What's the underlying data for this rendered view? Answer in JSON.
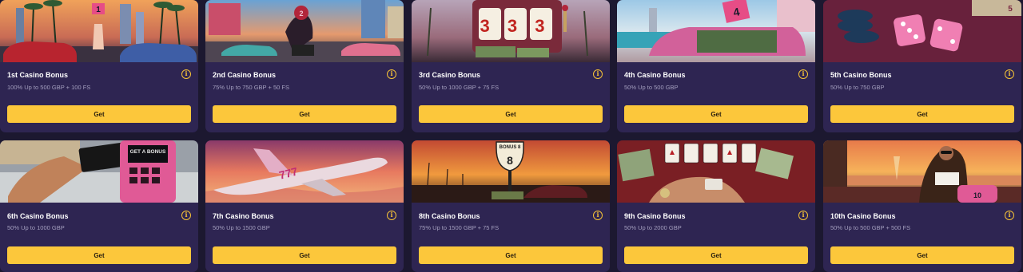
{
  "cards": [
    {
      "title": "1st Casino Bonus",
      "desc": "100% Up to 500 GBP + 100 FS",
      "button": "Get",
      "thumb_art": "palm-street-poster",
      "thumb_badge": "1"
    },
    {
      "title": "2nd Casino Bonus",
      "desc": "75% Up to 750 GBP + 50 FS",
      "button": "Get",
      "thumb_art": "biker-street-scene",
      "thumb_badge": "2"
    },
    {
      "title": "3rd Casino Bonus",
      "desc": "50% Up to 1000 GBP + 75 FS",
      "button": "Get",
      "thumb_art": "slot-machine-333",
      "thumb_badge": "3 3 3"
    },
    {
      "title": "4th Casino Bonus",
      "desc": "50% Up to 500 GBP",
      "button": "Get",
      "thumb_art": "pink-car-cash-trunk",
      "thumb_badge": "4"
    },
    {
      "title": "5th Casino Bonus",
      "desc": "50% Up to 750 GBP",
      "button": "Get",
      "thumb_art": "dice-and-chips",
      "thumb_badge": "5"
    },
    {
      "title": "6th Casino Bonus",
      "desc": "50% Up to 1000 GBP",
      "button": "Get",
      "thumb_art": "card-payment-terminal",
      "thumb_badge": "GET A BONUS"
    },
    {
      "title": "7th Casino Bonus",
      "desc": "50% Up to 1500 GBP",
      "button": "Get",
      "thumb_art": "jet-777-sunset",
      "thumb_badge": "777"
    },
    {
      "title": "8th Casino Bonus",
      "desc": "75% Up to 1500 GBP + 75 FS",
      "button": "Get",
      "thumb_art": "bonus-road-sign",
      "thumb_badge": "BONUS 8"
    },
    {
      "title": "9th Casino Bonus",
      "desc": "50% Up to 2000 GBP",
      "button": "Get",
      "thumb_art": "poker-cards-cash",
      "thumb_badge": ""
    },
    {
      "title": "10th Casino Bonus",
      "desc": "50% Up to 500 GBP + 500 FS",
      "button": "Get",
      "thumb_art": "woman-beach-sunset",
      "thumb_badge": "10"
    }
  ],
  "info_glyph": "i",
  "colors": {
    "page_bg": "#1c1830",
    "card_bg": "#2e2552",
    "button_bg": "#fcc73b",
    "accent": "#f5c237",
    "desc_text": "#a49fbf"
  }
}
